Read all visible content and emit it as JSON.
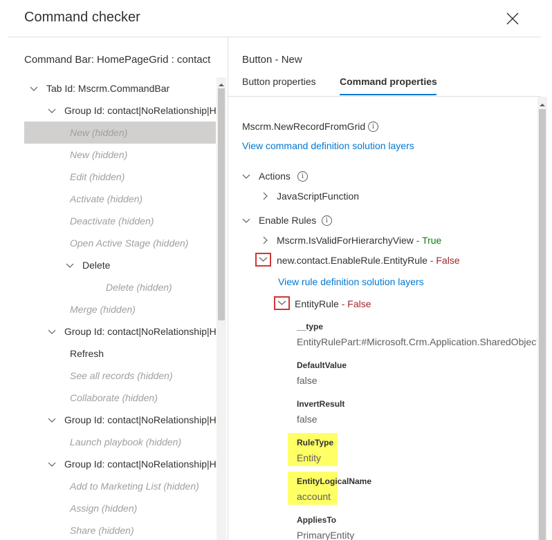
{
  "dialog": {
    "title": "Command checker"
  },
  "left": {
    "title": "Command Bar: HomePageGrid : contact",
    "tree": [
      {
        "label": "Tab Id: Mscrm.CommandBar",
        "indent": 0,
        "chevron": "down",
        "hidden": false,
        "selected": false
      },
      {
        "label": "Group Id: contact|NoRelationship|HomePageGrid|Mscrm.HomepageGrid.contact.MainTab.Management",
        "indent": 1,
        "chevron": "down",
        "hidden": false,
        "selected": false
      },
      {
        "label": "New (hidden)",
        "indent": 2,
        "chevron": "",
        "hidden": true,
        "selected": true
      },
      {
        "label": "New (hidden)",
        "indent": 2,
        "chevron": "",
        "hidden": true,
        "selected": false
      },
      {
        "label": "Edit (hidden)",
        "indent": 2,
        "chevron": "",
        "hidden": true,
        "selected": false
      },
      {
        "label": "Activate (hidden)",
        "indent": 2,
        "chevron": "",
        "hidden": true,
        "selected": false
      },
      {
        "label": "Deactivate (hidden)",
        "indent": 2,
        "chevron": "",
        "hidden": true,
        "selected": false
      },
      {
        "label": "Open Active Stage (hidden)",
        "indent": 2,
        "chevron": "",
        "hidden": true,
        "selected": false
      },
      {
        "label": "Delete",
        "indent": 2,
        "chevron": "down",
        "hidden": false,
        "selected": false
      },
      {
        "label": "Delete (hidden)",
        "indent": 3,
        "chevron": "",
        "hidden": true,
        "selected": false
      },
      {
        "label": "Merge (hidden)",
        "indent": 2,
        "chevron": "",
        "hidden": true,
        "selected": false
      },
      {
        "label": "Group Id: contact|NoRelationship|HomePageGrid|Mscrm.HomepageGrid.contact.MainTab.ModernClient",
        "indent": 1,
        "chevron": "down",
        "hidden": false,
        "selected": false
      },
      {
        "label": "Refresh",
        "indent": 2,
        "chevron": "",
        "hidden": false,
        "selected": false
      },
      {
        "label": "See all records (hidden)",
        "indent": 2,
        "chevron": "",
        "hidden": true,
        "selected": false
      },
      {
        "label": "Collaborate (hidden)",
        "indent": 2,
        "chevron": "",
        "hidden": true,
        "selected": false
      },
      {
        "label": "Group Id: contact|NoRelationship|HomePageGrid|Mscrm.HomepageGrid.contact.MainTab.Playbook",
        "indent": 1,
        "chevron": "down",
        "hidden": false,
        "selected": false
      },
      {
        "label": "Launch playbook (hidden)",
        "indent": 2,
        "chevron": "",
        "hidden": true,
        "selected": false
      },
      {
        "label": "Group Id: contact|NoRelationship|HomePageGrid|Mscrm.HomepageGrid.contact.MainTab.Collaborate",
        "indent": 1,
        "chevron": "down",
        "hidden": false,
        "selected": false
      },
      {
        "label": "Add to Marketing List (hidden)",
        "indent": 2,
        "chevron": "",
        "hidden": true,
        "selected": false
      },
      {
        "label": "Assign (hidden)",
        "indent": 2,
        "chevron": "",
        "hidden": true,
        "selected": false
      },
      {
        "label": "Share (hidden)",
        "indent": 2,
        "chevron": "",
        "hidden": true,
        "selected": false
      }
    ]
  },
  "right": {
    "button_title": "Button - New",
    "tabs": [
      {
        "label": "Button properties",
        "active": false
      },
      {
        "label": "Command properties",
        "active": true
      }
    ],
    "command_name": "Mscrm.NewRecordFromGrid",
    "view_command_link": "View command definition solution layers",
    "actions_label": "Actions",
    "action_item": "JavaScriptFunction",
    "enable_rules_label": "Enable Rules",
    "rule1": {
      "name": "Mscrm.IsValidForHierarchyView",
      "sep": " - ",
      "result": "True"
    },
    "rule2": {
      "name": "new.contact.EnableRule.EntityRule",
      "sep": " - ",
      "result": "False"
    },
    "view_rule_link": "View rule definition solution layers",
    "entity_rule": {
      "name": "EntityRule",
      "sep": " - ",
      "result": "False"
    },
    "properties": [
      {
        "label": "__type",
        "value": "EntityRulePart:#Microsoft.Crm.Application.SharedObjects.RibbonRules",
        "highlight": false
      },
      {
        "label": "DefaultValue",
        "value": "false",
        "highlight": false
      },
      {
        "label": "InvertResult",
        "value": "false",
        "highlight": false
      },
      {
        "label": "RuleType",
        "value": "Entity",
        "highlight": true
      },
      {
        "label": "EntityLogicalName",
        "value": "account",
        "highlight": true
      },
      {
        "label": "AppliesTo",
        "value": "PrimaryEntity",
        "highlight": false
      }
    ]
  },
  "icons": {
    "close": "close-icon",
    "chevron_down": "chevron-down-icon",
    "chevron_right": "chevron-right-icon",
    "info": "info-icon"
  },
  "colors": {
    "link": "#0078d4",
    "true": "#107c10",
    "false": "#a4262c",
    "highlight": "#ffff66",
    "redbox": "#d13438",
    "selected_row": "#d2d0ce"
  }
}
